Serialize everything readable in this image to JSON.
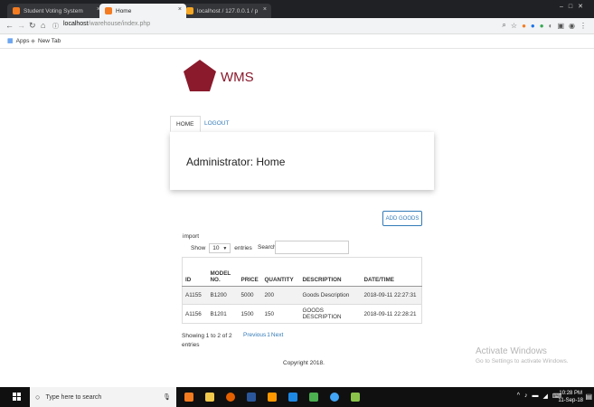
{
  "browser": {
    "tabs": [
      {
        "title": "Student Voting System",
        "color": "#f47b20"
      },
      {
        "title": "Home",
        "color": "#f47b20"
      },
      {
        "title": "localhost / 127.0.0.1 / p",
        "color": "#f5a623"
      }
    ],
    "url_host": "localhost",
    "url_path": "/warehouse/index.php",
    "bookmarks": {
      "apps": "Apps",
      "newtab": "New Tab"
    }
  },
  "page": {
    "brand": "WMS",
    "brand_color": "#8a1a2c",
    "nav": {
      "home": "HOME",
      "logout": "LOGOUT"
    },
    "heading": "Administrator: Home",
    "add_goods": "ADD GOODS",
    "import_label": "import",
    "show_label": "Show",
    "entries_value": "10",
    "entries_label": "entries",
    "search_label": "Search:",
    "table": {
      "headers": [
        "ID",
        "MODEL NO.",
        "PRICE",
        "QUANTITY",
        "DESCRIPTION",
        "DATE/TIME"
      ],
      "rows": [
        [
          "A1155",
          "B1200",
          "5000",
          "200",
          "Goods Description",
          "2018-09-11 22:27:31"
        ],
        [
          "A1156",
          "B1201",
          "1500",
          "150",
          "GOODS DESCRIPTION",
          "2018-09-11 22:28:21"
        ]
      ]
    },
    "info": "Showing 1 to 2 of 2 entries",
    "pager": {
      "previous": "Previous",
      "page": "1",
      "next": "Next"
    },
    "footer": "Copyright 2018."
  },
  "watermark": {
    "line1": "Activate Windows",
    "line2": "Go to Settings to activate Windows."
  },
  "taskbar": {
    "search_placeholder": "Type here to search",
    "time": "10:28 PM",
    "date": "11-Sep-18"
  }
}
